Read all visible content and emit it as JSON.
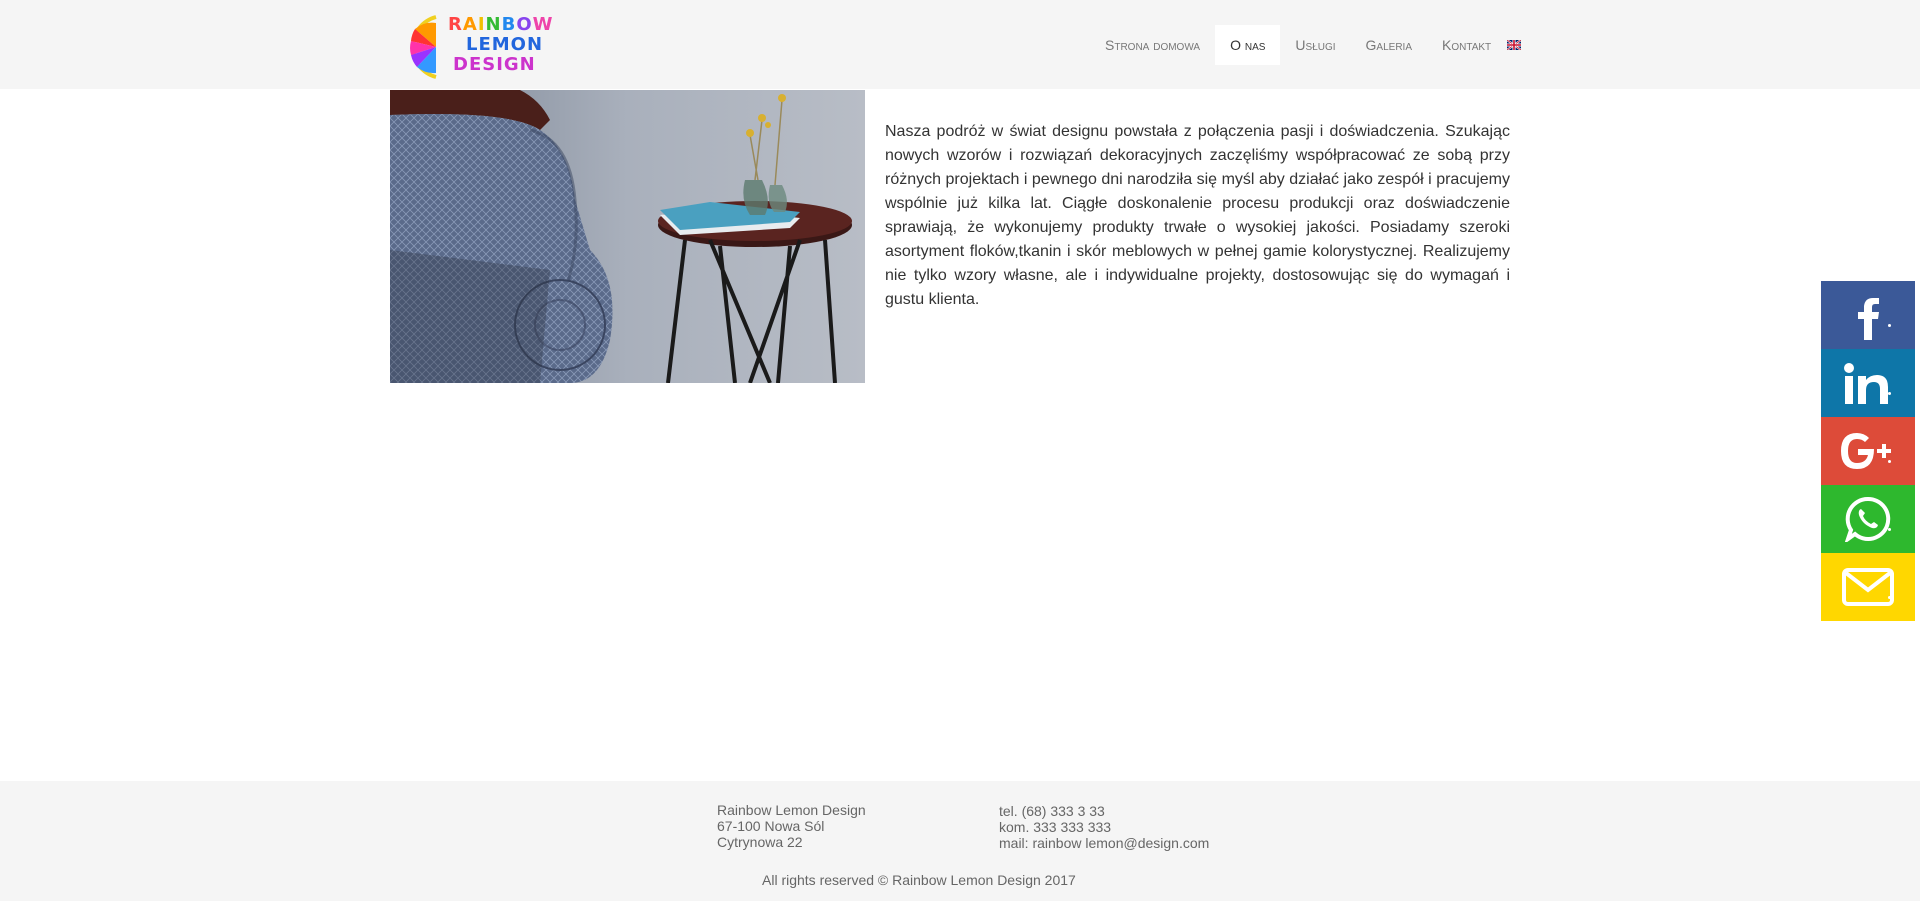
{
  "brand": {
    "logo_line1": "RAINBOW",
    "logo_line2": "LEMON",
    "logo_line3": "DESIGN"
  },
  "nav": {
    "items": [
      {
        "label": "Strona domowa",
        "active": false
      },
      {
        "label": "O nas",
        "active": true
      },
      {
        "label": "Usługi",
        "active": false
      },
      {
        "label": "Galeria",
        "active": false
      },
      {
        "label": "Kontakt",
        "active": false
      }
    ],
    "language_icon": "uk-flag-icon"
  },
  "main": {
    "about_text": "Nasza podróż w świat designu powstała z połączenia pasji i doświadczenia. Szukając nowych wzorów i rozwiązań dekoracyjnych zaczęliśmy współpracować ze sobą przy różnych projektach i pewnego dni narodziła się myśl aby działać jako zespół i pracujemy wspólnie już kilka lat. Ciągłe doskonalenie procesu produkcji oraz doświadczenie sprawiają, że wykonujemy produkty trwałe o wysokiej jakości. Posiadamy szeroki asortyment floków,tkanin i skór meblowych w pełnej gamie kolorystycznej. Realizujemy nie tylko wzory własne, ale i indywidualne projekty, dostosowując się do wymagań i gustu klienta."
  },
  "social": [
    {
      "name": "facebook-icon",
      "color": "#3b5998"
    },
    {
      "name": "linkedin-icon",
      "color": "#0e76a8"
    },
    {
      "name": "google-plus-icon",
      "color": "#dd4b39"
    },
    {
      "name": "whatsapp-icon",
      "color": "#2eb82e"
    },
    {
      "name": "email-icon",
      "color": "#ffd700"
    }
  ],
  "footer": {
    "address": [
      "Rainbow Lemon Design",
      "67-100 Nowa Sól",
      "Cytrynowa 22"
    ],
    "contact": [
      "tel. (68) 333 3 33",
      "kom. 333 333 333",
      "mail: rainbow lemon@design.com"
    ],
    "copyright": "All rights reserved © Rainbow Lemon Design 2017"
  },
  "colors": {
    "header_bg": "#f5f5f5",
    "footer_bg": "#f5f5f5"
  }
}
